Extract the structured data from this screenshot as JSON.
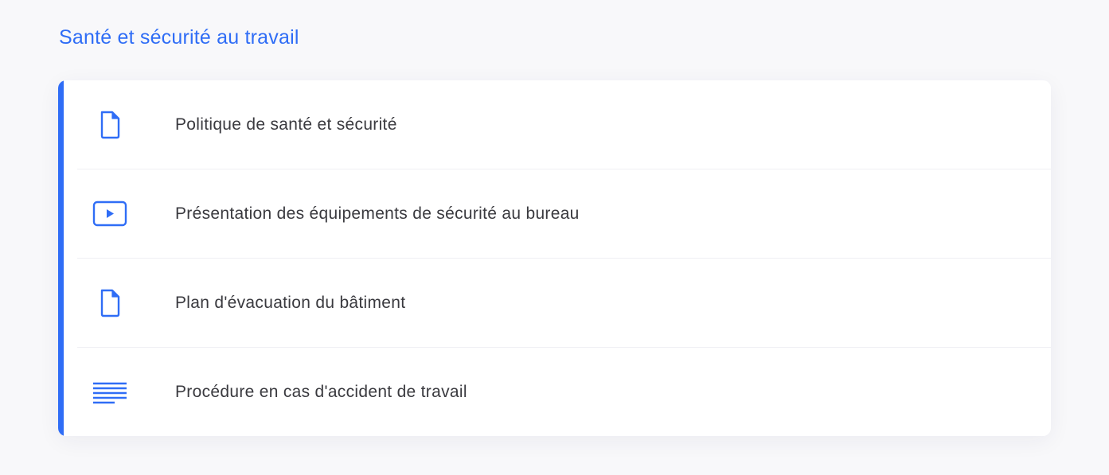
{
  "section": {
    "title": "Santé et sécurité au travail"
  },
  "colors": {
    "accent": "#2f6df6",
    "text": "#3a3a3f",
    "background": "#f8f8fa"
  },
  "items": [
    {
      "icon": "document-icon",
      "label": "Politique de santé et sécurité"
    },
    {
      "icon": "video-play-icon",
      "label": "Présentation des équipements de sécurité au bureau"
    },
    {
      "icon": "document-icon",
      "label": "Plan d'évacuation du bâtiment"
    },
    {
      "icon": "text-lines-icon",
      "label": "Procédure en cas d'accident de travail"
    }
  ]
}
